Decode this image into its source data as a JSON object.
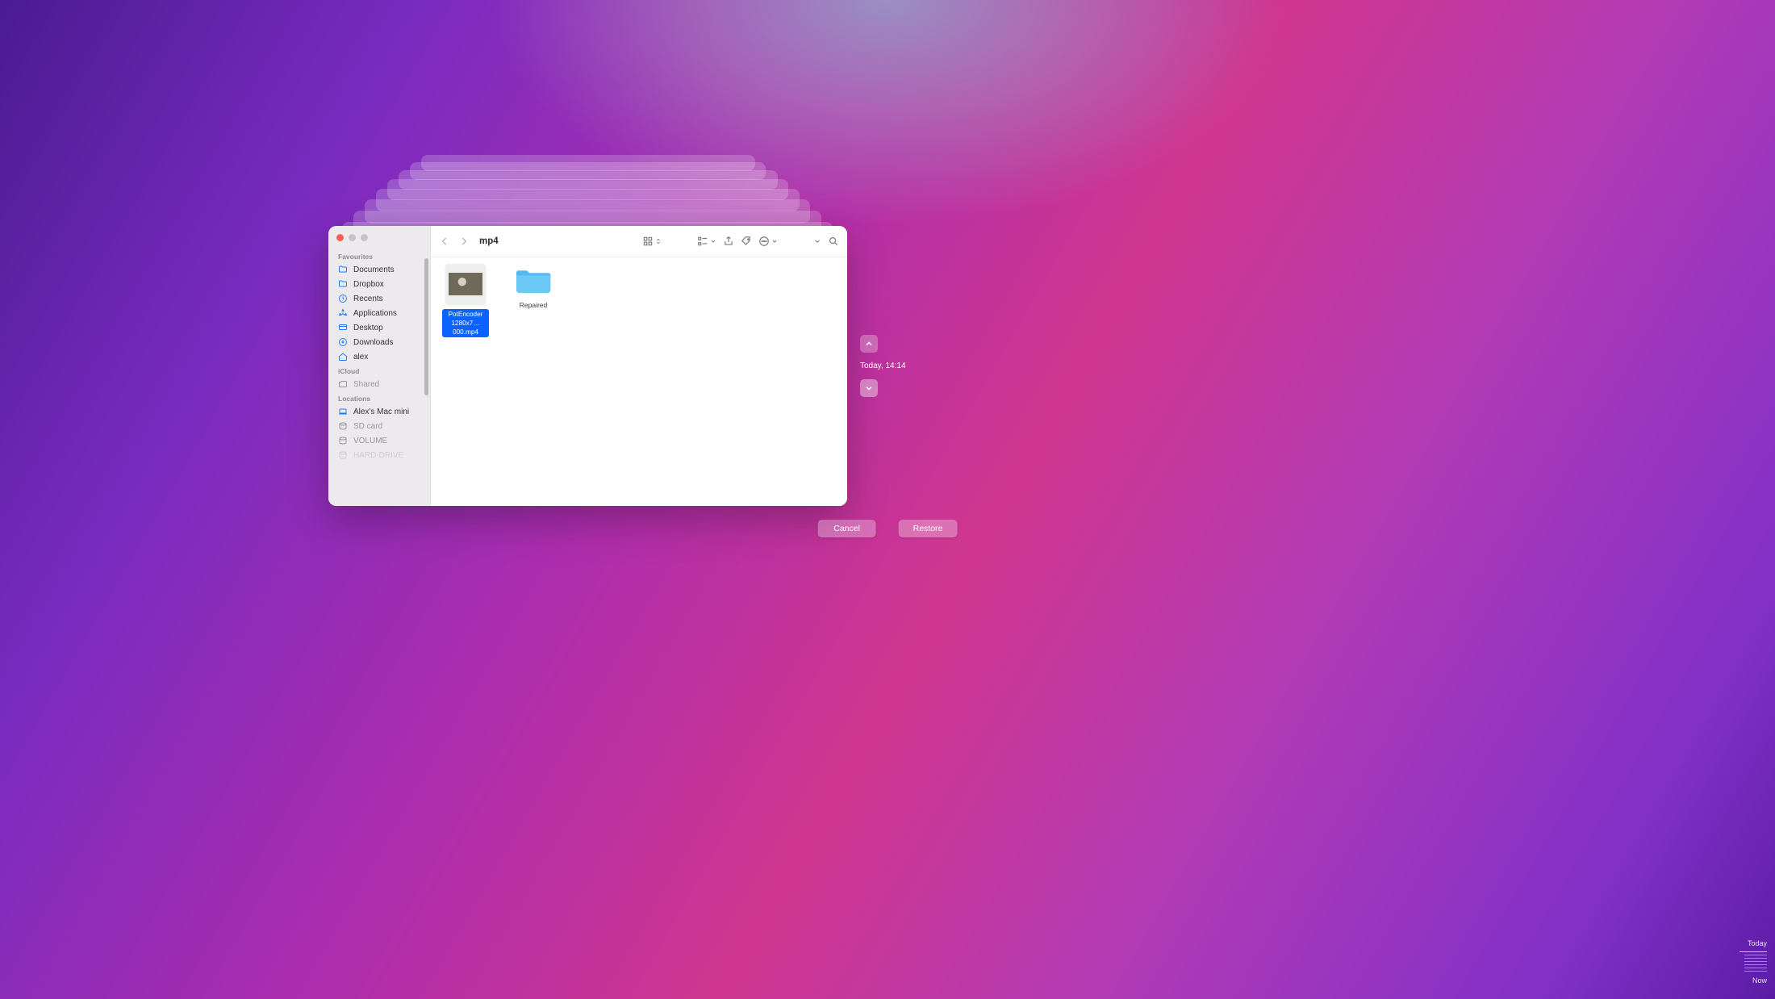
{
  "window": {
    "title": "mp4"
  },
  "sidebar": {
    "sections": [
      {
        "header": "Favourites",
        "items": [
          {
            "icon": "folder-icon",
            "label": "Documents",
            "dim": false
          },
          {
            "icon": "folder-icon",
            "label": "Dropbox",
            "dim": false
          },
          {
            "icon": "clock-icon",
            "label": "Recents",
            "dim": false
          },
          {
            "icon": "apps-icon",
            "label": "Applications",
            "dim": false
          },
          {
            "icon": "folder-icon",
            "label": "Desktop",
            "dim": false
          },
          {
            "icon": "download-icon",
            "label": "Downloads",
            "dim": false
          },
          {
            "icon": "home-icon",
            "label": "alex",
            "dim": false
          }
        ]
      },
      {
        "header": "iCloud",
        "items": [
          {
            "icon": "shared-icon",
            "label": "Shared",
            "dim": true
          }
        ]
      },
      {
        "header": "Locations",
        "items": [
          {
            "icon": "laptop-icon",
            "label": "Alex's Mac mini",
            "dim": false
          },
          {
            "icon": "disk-icon",
            "label": "SD card",
            "dim": true
          },
          {
            "icon": "disk-icon",
            "label": "VOLUME",
            "dim": true
          },
          {
            "icon": "disk-icon",
            "label": "HARD-DRIVE",
            "dim": true
          }
        ]
      }
    ]
  },
  "items": [
    {
      "kind": "video",
      "name_line1": "PotEncoder",
      "name_line2": "1280x7…000.mp4",
      "selected": true
    },
    {
      "kind": "folder",
      "name": "Repaired",
      "selected": false
    }
  ],
  "actions": {
    "cancel": "Cancel",
    "restore": "Restore"
  },
  "timenav": {
    "label": "Today, 14:14"
  },
  "timeline": {
    "top": "Today",
    "bottom": "Now"
  }
}
